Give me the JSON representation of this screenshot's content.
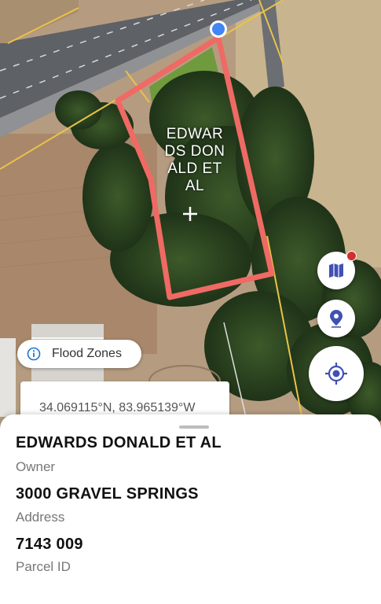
{
  "map": {
    "parcel_label": "EDWARDS DONALD ET AL",
    "parcel_label_lines": [
      "EDWAR",
      "DS DON",
      "ALD ET",
      "AL"
    ],
    "parcel_outline_color": "#ef6a64",
    "location_dot_color": "#4285f4"
  },
  "flood_zones": {
    "label": "Flood Zones",
    "icon": "info-icon"
  },
  "coordinates": {
    "text": "34.069115°N, 83.965139°W"
  },
  "controls": {
    "layers_icon": "map-layers-icon",
    "pin_icon": "location-pin-icon",
    "locate_icon": "my-location-icon",
    "accent": "#3f51b5",
    "notification_dot_color": "#d32f2f"
  },
  "sheet": {
    "owner_value": "EDWARDS DONALD ET AL",
    "owner_label": "Owner",
    "address_value": "3000 GRAVEL SPRINGS",
    "address_label": "Address",
    "parcel_id_value": "7143 009",
    "parcel_id_label": "Parcel ID"
  }
}
